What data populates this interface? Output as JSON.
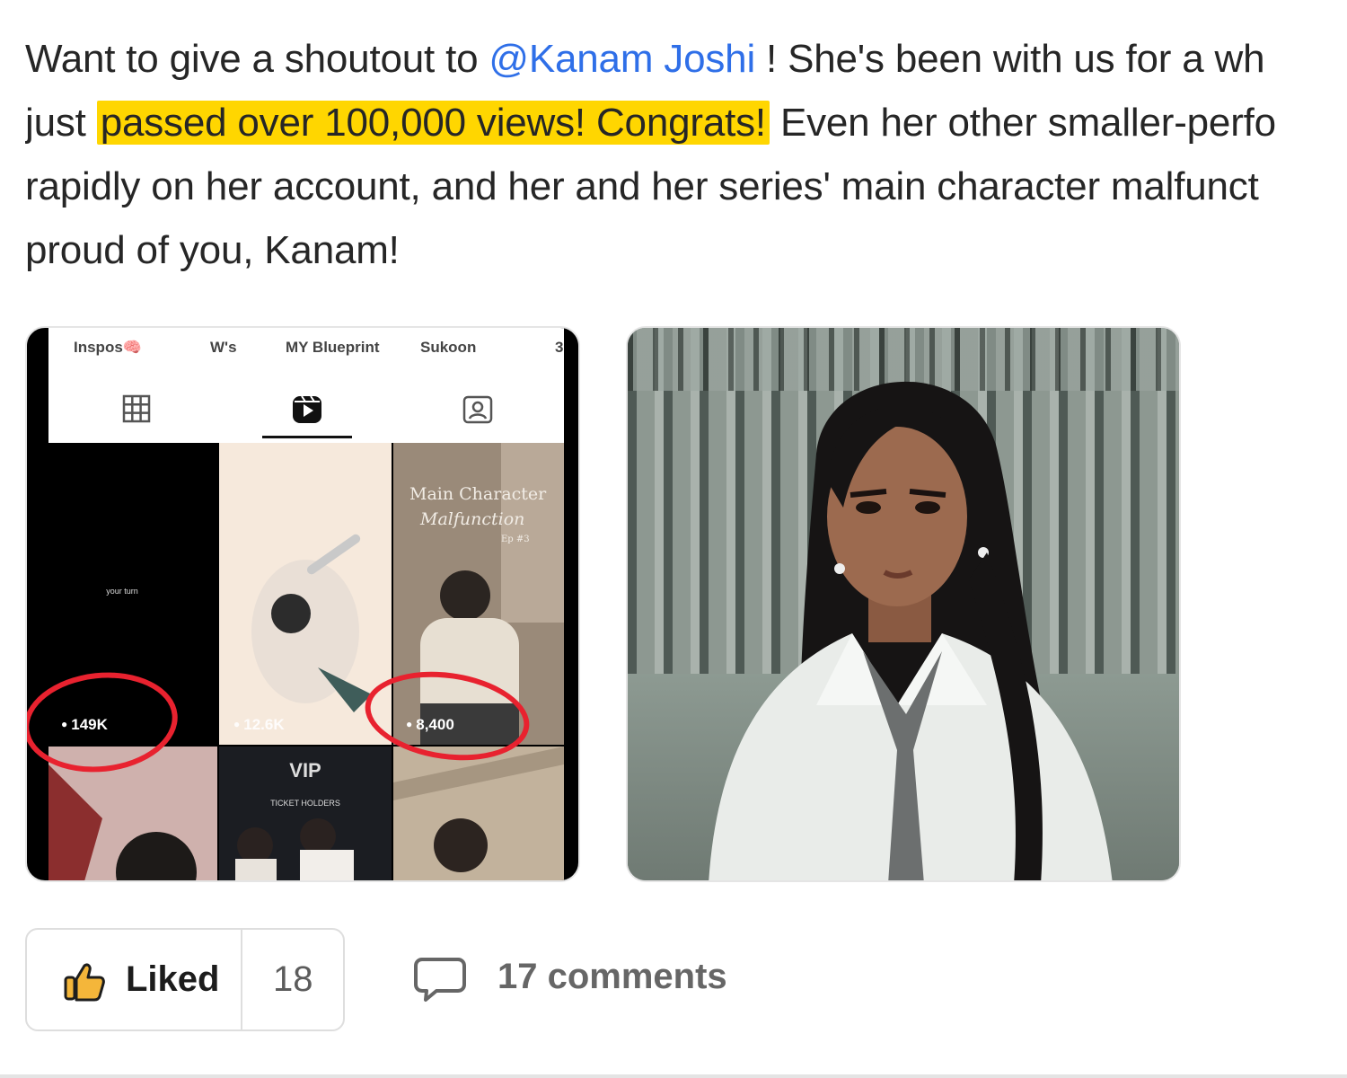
{
  "post": {
    "line1_prefix": "Want to give a shoutout to ",
    "mention": "@Kanam Joshi",
    "line1_suffix": " ! She's been with us for a wh",
    "line2_prefix": "just ",
    "highlight": "passed over 100,000 views! Congrats!",
    "line2_suffix": " Even her other smaller-perfo",
    "line3": "rapidly on her account, and her and her series' main character malfunct",
    "line4": "proud of you, Kanam!"
  },
  "colors": {
    "mention": "#2f6fe8",
    "highlight": "#ffd600",
    "annotation": "#e8222f"
  },
  "screenshot": {
    "highlights": [
      "Inspos🧠",
      "W's",
      "MY Blueprint",
      "Sukoon",
      "3"
    ],
    "tabs": [
      "grid-icon",
      "reels-icon",
      "tagged-icon"
    ],
    "cells": [
      {
        "caption": "your turn",
        "views": "149K"
      },
      {
        "views": "12.6K"
      },
      {
        "title": "Main Character",
        "subtitle": "Malfunction",
        "episode": "Ep #3",
        "views": "8,400"
      },
      {
        "label": ""
      },
      {
        "label": "VIP",
        "sublabel": "TICKET HOLDERS"
      },
      {
        "label": ""
      }
    ]
  },
  "actions": {
    "like_label": "Liked",
    "like_count": "18",
    "comments_label": "17 comments"
  }
}
